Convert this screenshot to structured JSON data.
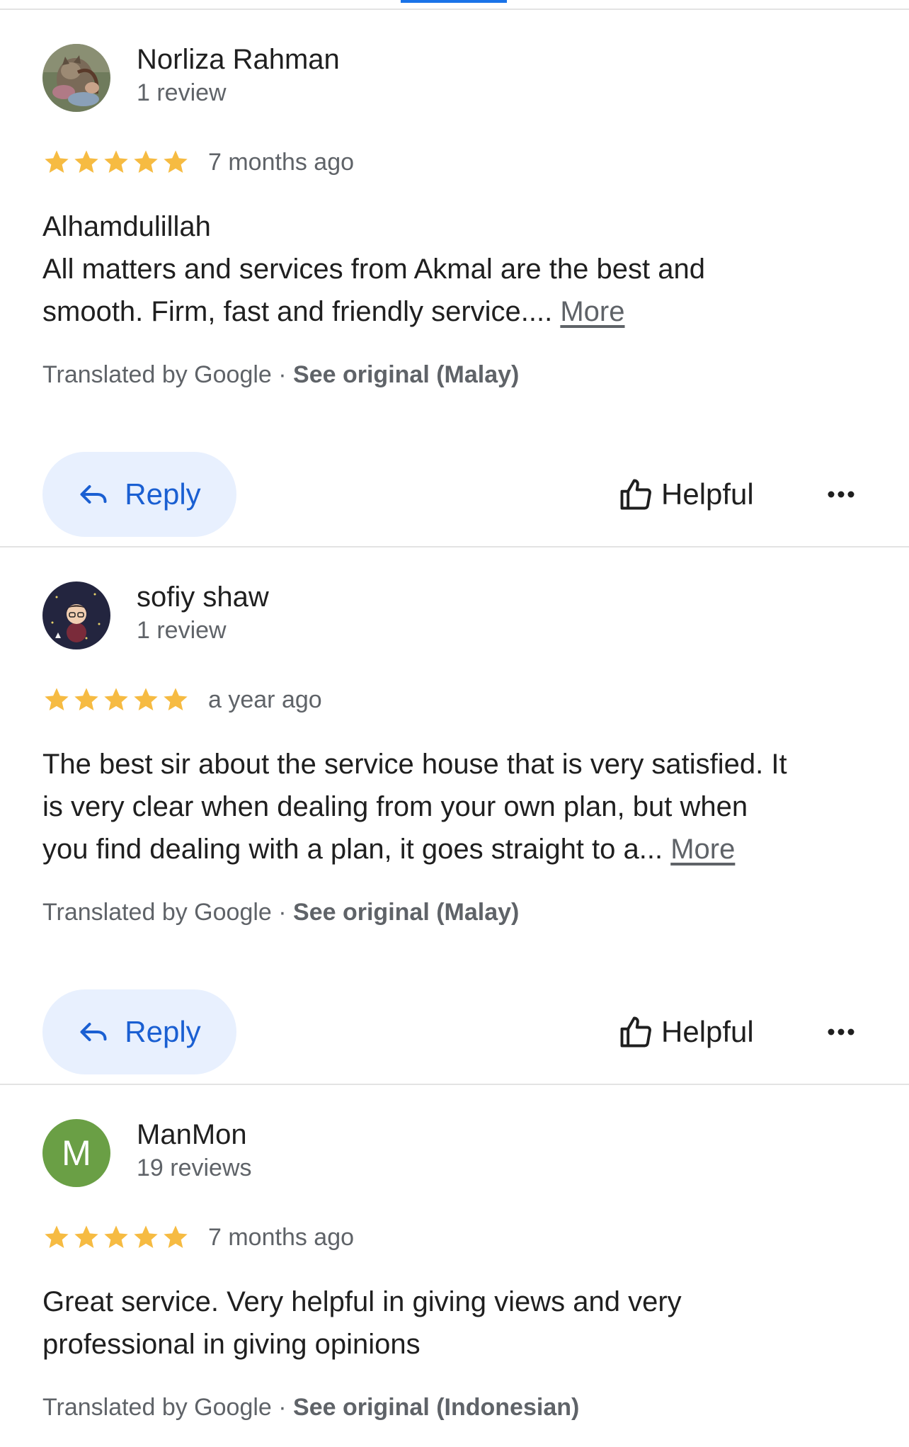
{
  "colors": {
    "accent": "#1a73e8",
    "reply_bg": "#e8f0fe",
    "reply_text": "#1a5fd2",
    "star": "#f6bb42",
    "secondary_text": "#5f6368",
    "avatar_manmon": "#6a9f45"
  },
  "reviews": [
    {
      "reviewer": "Norliza Rahman",
      "review_count": "1 review",
      "avatar_icon": "cat-photo-avatar",
      "rating": 5,
      "date": "7 months ago",
      "text_lines": [
        "Alhamdulillah",
        "All matters and services from Akmal are the best and",
        "smooth. Firm, fast and friendly service...."
      ],
      "more_label": "More",
      "translated_by": "Translated by Google · ",
      "see_original": "See original (Malay)",
      "reply_label": "Reply",
      "helpful_label": "Helpful"
    },
    {
      "reviewer": "sofiy shaw",
      "review_count": "1 review",
      "avatar_icon": "cartoon-character-avatar",
      "rating": 5,
      "date": "a year ago",
      "text_lines": [
        "The best sir about the service house that is very satisfied. It",
        "is very clear when dealing from your own plan, but when",
        "you find dealing with a plan, it goes straight to a..."
      ],
      "more_label": "More",
      "translated_by": "Translated by Google · ",
      "see_original": "See original (Malay)",
      "reply_label": "Reply",
      "helpful_label": "Helpful"
    },
    {
      "reviewer": "ManMon",
      "review_count": "19 reviews",
      "avatar_letter": "M",
      "rating": 5,
      "date": "7 months ago",
      "text_lines": [
        "Great service. Very helpful in giving views and very",
        "professional in giving opinions"
      ],
      "translated_by": "Translated by Google · ",
      "see_original": "See original (Indonesian)"
    }
  ]
}
